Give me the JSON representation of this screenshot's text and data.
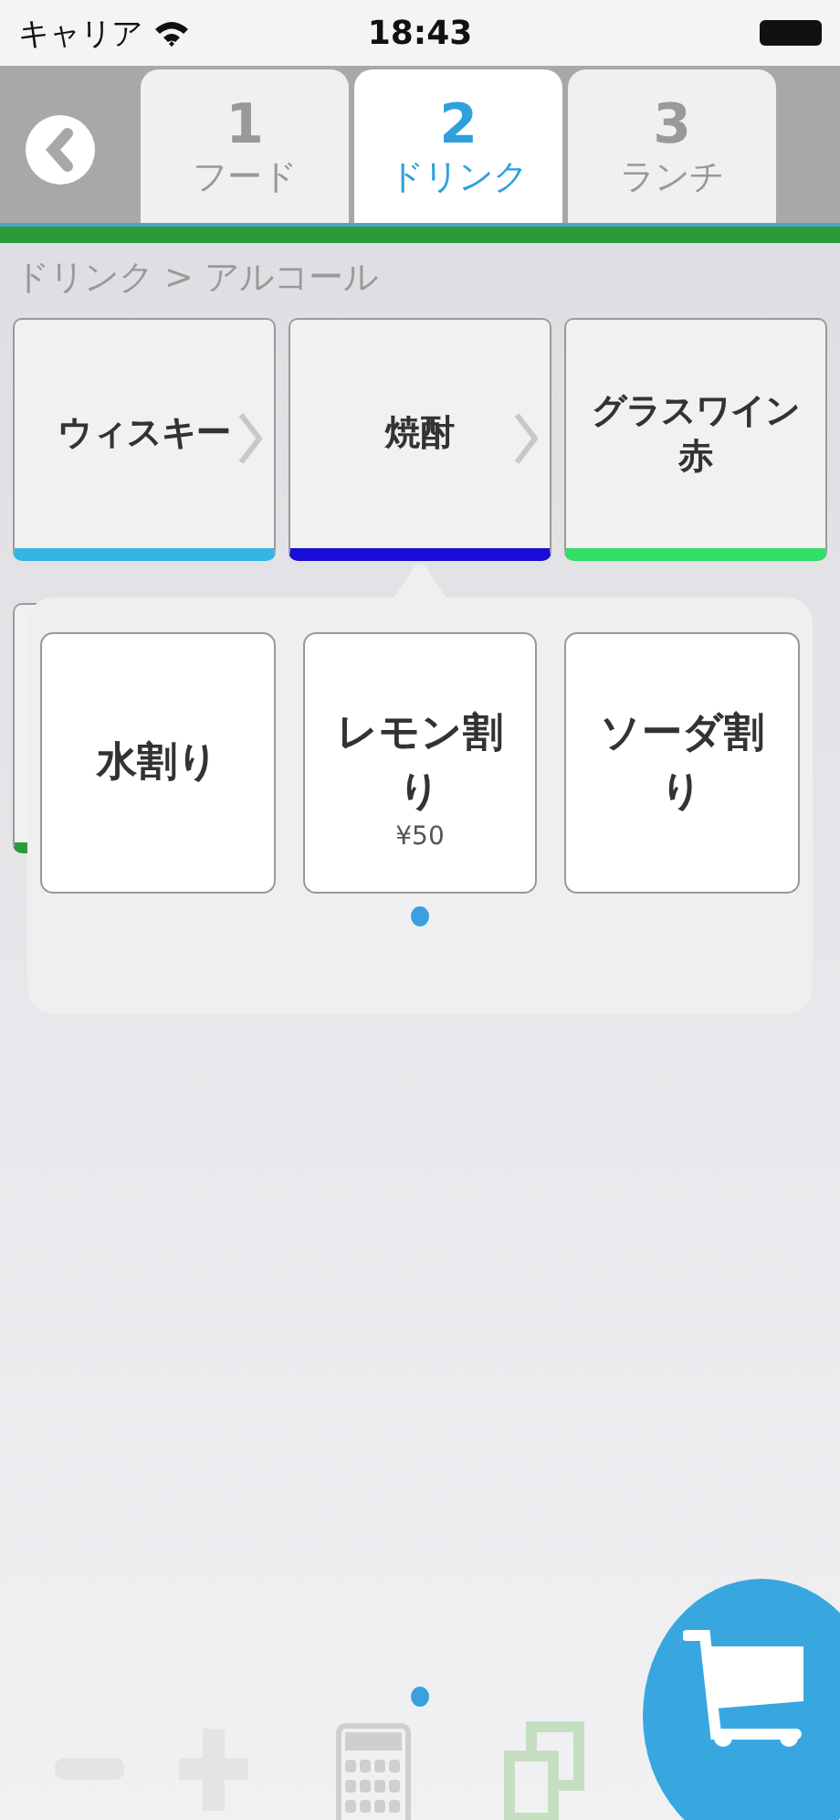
{
  "status_bar": {
    "carrier": "キャリア",
    "time": "18:43"
  },
  "tabs": [
    {
      "number": "1",
      "label": "フード",
      "selected": false
    },
    {
      "number": "2",
      "label": "ドリンク",
      "selected": true
    },
    {
      "number": "3",
      "label": "ランチ",
      "selected": false
    }
  ],
  "breadcrumb": "ドリンク > アルコール",
  "categories": [
    {
      "name": "ウィスキー",
      "color": "#33b5e5",
      "has_submenu": true
    },
    {
      "name": "焼酎",
      "color": "#1a0fd6",
      "has_submenu": true
    },
    {
      "name": "グラスワイン赤",
      "color": "#33dd66",
      "has_submenu": false
    }
  ],
  "submenu": {
    "items": [
      {
        "name": "水割り"
      },
      {
        "name": "レモン割り",
        "price": "¥50"
      },
      {
        "name": "ソーダ割り"
      }
    ]
  }
}
